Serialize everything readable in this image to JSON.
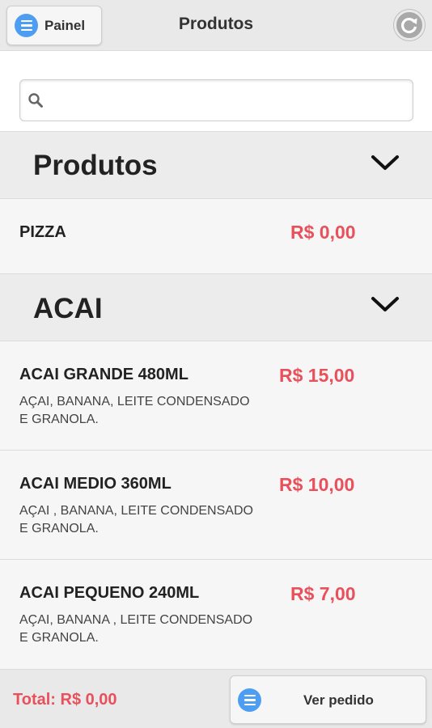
{
  "header": {
    "menu_label": "Painel",
    "title": "Produtos"
  },
  "search": {
    "placeholder": "",
    "value": ""
  },
  "categories": [
    {
      "name": "Produtos",
      "items": [
        {
          "name": "PIZZA",
          "price": "R$ 0,00",
          "description": ""
        }
      ]
    },
    {
      "name": "ACAI",
      "items": [
        {
          "name": "ACAI GRANDE 480ML",
          "price": "R$ 15,00",
          "description": "AÇAI, BANANA, LEITE CONDENSADO E GRANOLA."
        },
        {
          "name": "ACAI MEDIO 360ML",
          "price": "R$ 10,00",
          "description": "AÇAI , BANANA, LEITE CONDENSADO E GRANOLA."
        },
        {
          "name": "ACAI PEQUENO 240ML",
          "price": "R$ 7,00",
          "description": "AÇAI, BANANA , LEITE CONDENSADO E GRANOLA."
        }
      ]
    }
  ],
  "footer": {
    "total": "Total: R$ 0,00",
    "order_button": "Ver pedido"
  },
  "colors": {
    "accent_blue": "#4d9ef3",
    "price_red": "#e8505b",
    "header_bg": "#e9e9e9"
  },
  "icons": {
    "menu": "list-icon",
    "refresh": "refresh-icon",
    "search": "search-icon",
    "expand": "chevron-down-icon",
    "order": "list-icon"
  }
}
